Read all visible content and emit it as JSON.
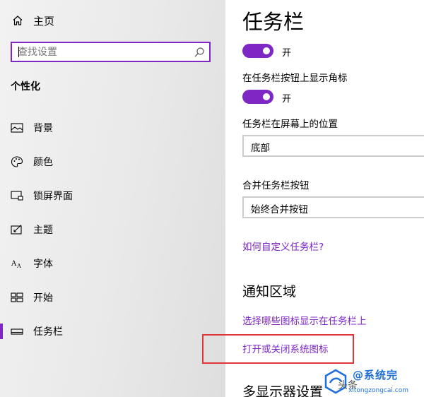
{
  "sidebar": {
    "home_label": "主页",
    "search_placeholder": "查找设置",
    "section_heading": "个性化",
    "items": [
      {
        "label": "背景",
        "icon": "picture-icon"
      },
      {
        "label": "颜色",
        "icon": "palette-icon"
      },
      {
        "label": "锁屏界面",
        "icon": "lock-screen-icon"
      },
      {
        "label": "主题",
        "icon": "theme-icon"
      },
      {
        "label": "字体",
        "icon": "font-icon"
      },
      {
        "label": "开始",
        "icon": "start-icon"
      },
      {
        "label": "任务栏",
        "icon": "taskbar-icon",
        "active": true
      }
    ]
  },
  "main": {
    "title": "任务栏",
    "toggle_1_state": "开",
    "badge_label": "在任务栏按钮上显示角标",
    "toggle_2_state": "开",
    "position_label": "任务栏在屏幕上的位置",
    "position_value": "底部",
    "combine_label": "合并任务栏按钮",
    "combine_value": "始终合并按钮",
    "customize_link": "如何自定义任务栏?",
    "notification_section": "通知区域",
    "select_icons_link": "选择哪些图标显示在任务栏上",
    "system_icons_link": "打开或关闭系统图标",
    "multi_display_section": "多显示器设置"
  },
  "watermark": {
    "toutiao": "头条",
    "logo_text": "@系统完",
    "domain": "xitongzongcai.com"
  },
  "colors": {
    "accent": "#7e27c4",
    "highlight_box": "#e03636",
    "sidebar_bg": "#ececec"
  }
}
